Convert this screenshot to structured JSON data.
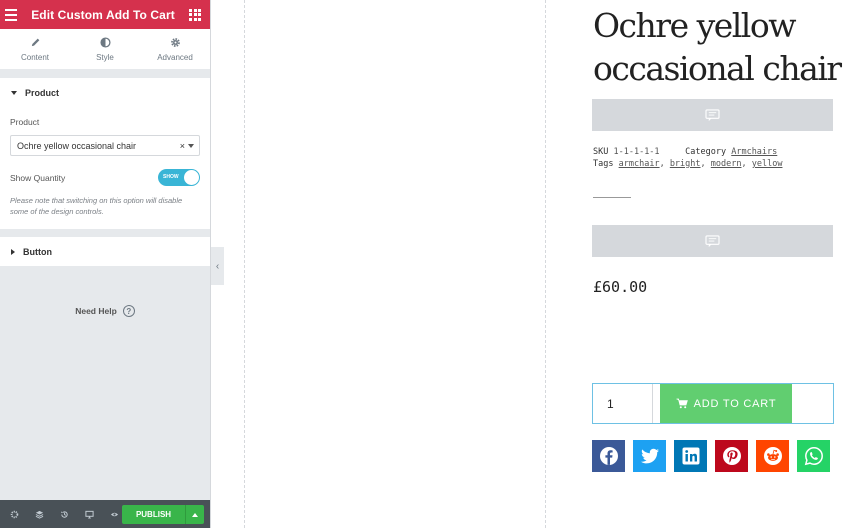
{
  "panel": {
    "title": "Edit Custom Add To Cart",
    "tabs": [
      {
        "label": "Content",
        "icon": "pencil-icon"
      },
      {
        "label": "Style",
        "icon": "half-circle-icon"
      },
      {
        "label": "Advanced",
        "icon": "gear-icon"
      }
    ],
    "product_section": {
      "heading": "Product",
      "product_label": "Product",
      "product_value": "Ochre yellow occasional chair",
      "clear_symbol": "×",
      "show_quantity_label": "Show Quantity",
      "toggle_text": "SHOW",
      "toggle_on": true,
      "note": "Please note that switching on this option will disable some of the design controls."
    },
    "button_section": {
      "heading": "Button"
    },
    "need_help": "Need Help",
    "help_symbol": "?",
    "collapse_symbol": "‹",
    "footer": {
      "icons": [
        "gear-icon",
        "layers-icon",
        "history-icon",
        "responsive-icon",
        "eye-icon"
      ],
      "publish_label": "PUBLISH"
    },
    "accent_color": "#d5314d"
  },
  "product": {
    "title": "Ochre yellow occasional chair",
    "sku_label": "SKU",
    "sku": "1-1-1-1-1",
    "category_label": "Category",
    "category": "Armchairs",
    "tags_label": "Tags",
    "tags": [
      "armchair",
      "bright",
      "modern",
      "yellow"
    ],
    "price": "£60.00",
    "quantity": "1",
    "add_to_cart_label": "ADD TO CART",
    "button_color": "#61ce70",
    "social": [
      {
        "name": "facebook",
        "color": "#3b5998"
      },
      {
        "name": "twitter",
        "color": "#1da1f2"
      },
      {
        "name": "linkedin",
        "color": "#0077b5"
      },
      {
        "name": "pinterest",
        "color": "#bd081c"
      },
      {
        "name": "reddit",
        "color": "#ff4500"
      },
      {
        "name": "whatsapp",
        "color": "#25d366"
      }
    ]
  }
}
